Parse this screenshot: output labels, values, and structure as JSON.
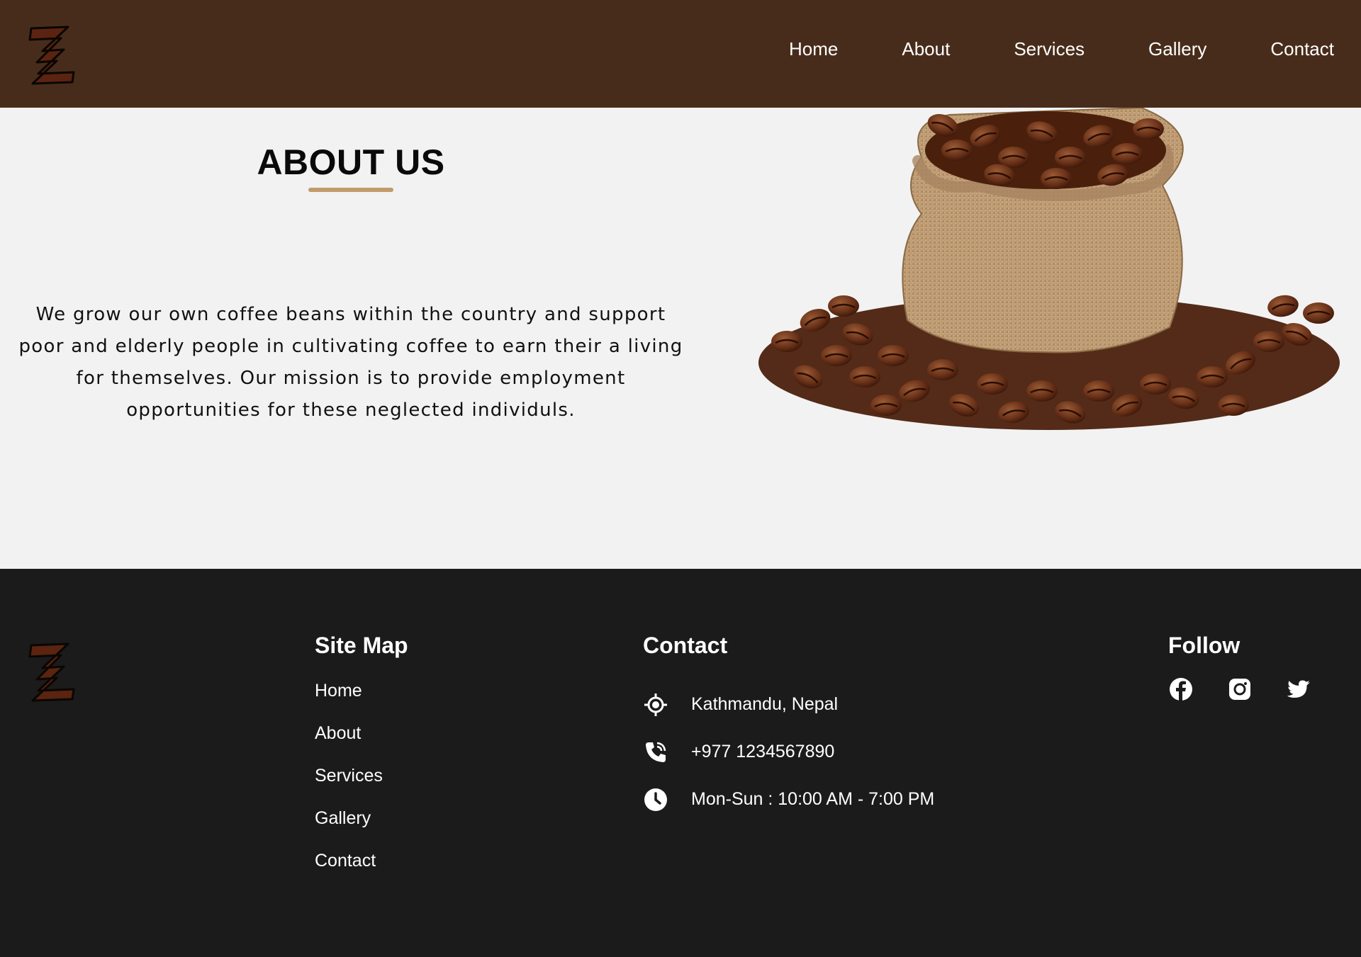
{
  "nav": {
    "items": [
      {
        "label": "Home"
      },
      {
        "label": "About"
      },
      {
        "label": "Services"
      },
      {
        "label": "Gallery"
      },
      {
        "label": "Contact"
      }
    ]
  },
  "about": {
    "title": "ABOUT US",
    "body": "We grow our own coffee beans within the country and support poor and elderly people in cultivating coffee to earn their a living for themselves. Our mission is to provide employment opportunities for these neglected individuls."
  },
  "footer": {
    "sitemap": {
      "title": "Site Map",
      "links": [
        "Home",
        "About",
        "Services",
        "Gallery",
        "Contact"
      ]
    },
    "contact": {
      "title": "Contact",
      "location": "Kathmandu, Nepal",
      "phone": "+977 1234567890",
      "hours": "Mon-Sun : 10:00 AM - 7:00 PM"
    },
    "follow": {
      "title": "Follow",
      "icons": [
        "facebook-icon",
        "instagram-icon",
        "twitter-icon"
      ]
    }
  },
  "colors": {
    "header_bg": "#482c1b",
    "accent": "#c19b6c",
    "footer_bg": "#1b1b1b",
    "page_bg": "#f2f2f2"
  }
}
